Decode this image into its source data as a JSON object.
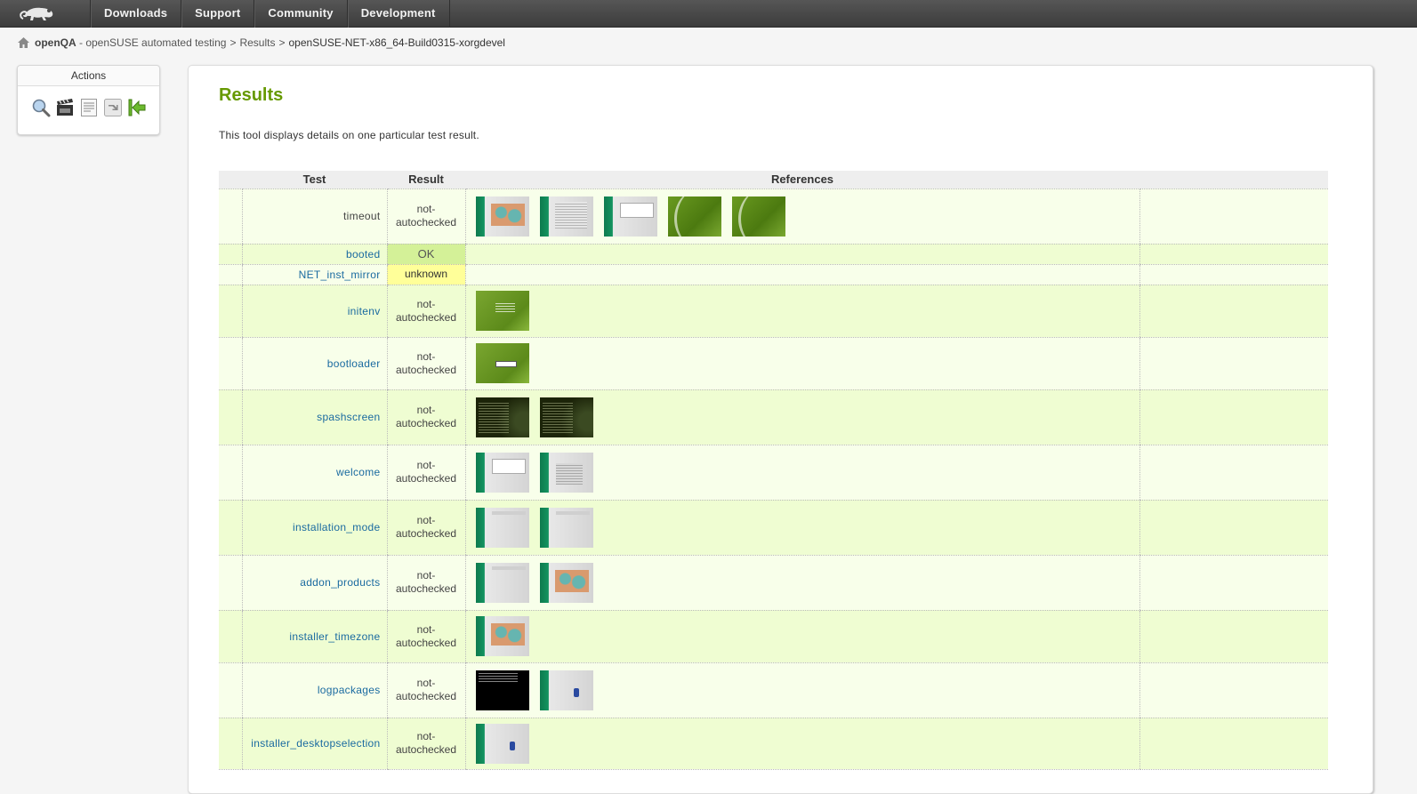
{
  "nav": {
    "logo": "opensuse-chameleon-logo",
    "items": [
      "Downloads",
      "Support",
      "Community",
      "Development"
    ]
  },
  "breadcrumb": {
    "home_icon": "home-icon",
    "site": "openQA",
    "site_suffix": " - openSUSE automated testing",
    "sep": ">",
    "results": "Results",
    "current": "openSUSE-NET-x86_64-Build0315-xorgdevel"
  },
  "actions": {
    "title": "Actions",
    "icons": [
      "magnifier-icon",
      "clapperboard-icon",
      "text-document-icon",
      "download-arrow-icon",
      "back-to-start-arrow-icon"
    ]
  },
  "main": {
    "title": "Results",
    "description": "This tool displays details on one particular test result.",
    "columns": {
      "blank": "",
      "test": "Test",
      "result": "Result",
      "references": "References",
      "extra": ""
    },
    "rows": [
      {
        "test": "timeout",
        "link": false,
        "result": "not-\nautochecked",
        "status": "notautochecked",
        "thumbs": [
          "t-inst t-map",
          "t-inst t-list",
          "t-inst t-dialog",
          "t-green",
          "t-green"
        ]
      },
      {
        "test": "booted",
        "link": true,
        "result": "OK",
        "status": "ok",
        "thumbs": []
      },
      {
        "test": "NET_inst_mirror",
        "link": true,
        "result": "unknown",
        "status": "unknown",
        "thumbs": []
      },
      {
        "test": "initenv",
        "link": true,
        "result": "not-\nautochecked",
        "status": "notautochecked",
        "thumbs": [
          "t-greenmenu"
        ]
      },
      {
        "test": "bootloader",
        "link": true,
        "result": "not-\nautochecked",
        "status": "notautochecked",
        "thumbs": [
          "t-greenmenu t-boot"
        ]
      },
      {
        "test": "spashscreen",
        "link": true,
        "result": "not-\nautochecked",
        "status": "notautochecked",
        "thumbs": [
          "t-term",
          "t-term"
        ]
      },
      {
        "test": "welcome",
        "link": true,
        "result": "not-\nautochecked",
        "status": "notautochecked",
        "thumbs": [
          "t-inst t-dialog",
          "t-inst t-text"
        ]
      },
      {
        "test": "installation_mode",
        "link": true,
        "result": "not-\nautochecked",
        "status": "notautochecked",
        "thumbs": [
          "t-inst t-plain",
          "t-inst t-plain"
        ]
      },
      {
        "test": "addon_products",
        "link": true,
        "result": "not-\nautochecked",
        "status": "notautochecked",
        "thumbs": [
          "t-inst t-plain",
          "t-inst t-map"
        ]
      },
      {
        "test": "installer_timezone",
        "link": true,
        "result": "not-\nautochecked",
        "status": "notautochecked",
        "thumbs": [
          "t-inst t-map"
        ]
      },
      {
        "test": "logpackages",
        "link": true,
        "result": "not-\nautochecked",
        "status": "notautochecked",
        "thumbs": [
          "t-black",
          "t-inst t-desk"
        ]
      },
      {
        "test": "installer_desktopselection",
        "link": true,
        "result": "not-\nautochecked",
        "status": "notautochecked",
        "thumbs": [
          "t-inst t-desk"
        ]
      }
    ]
  }
}
